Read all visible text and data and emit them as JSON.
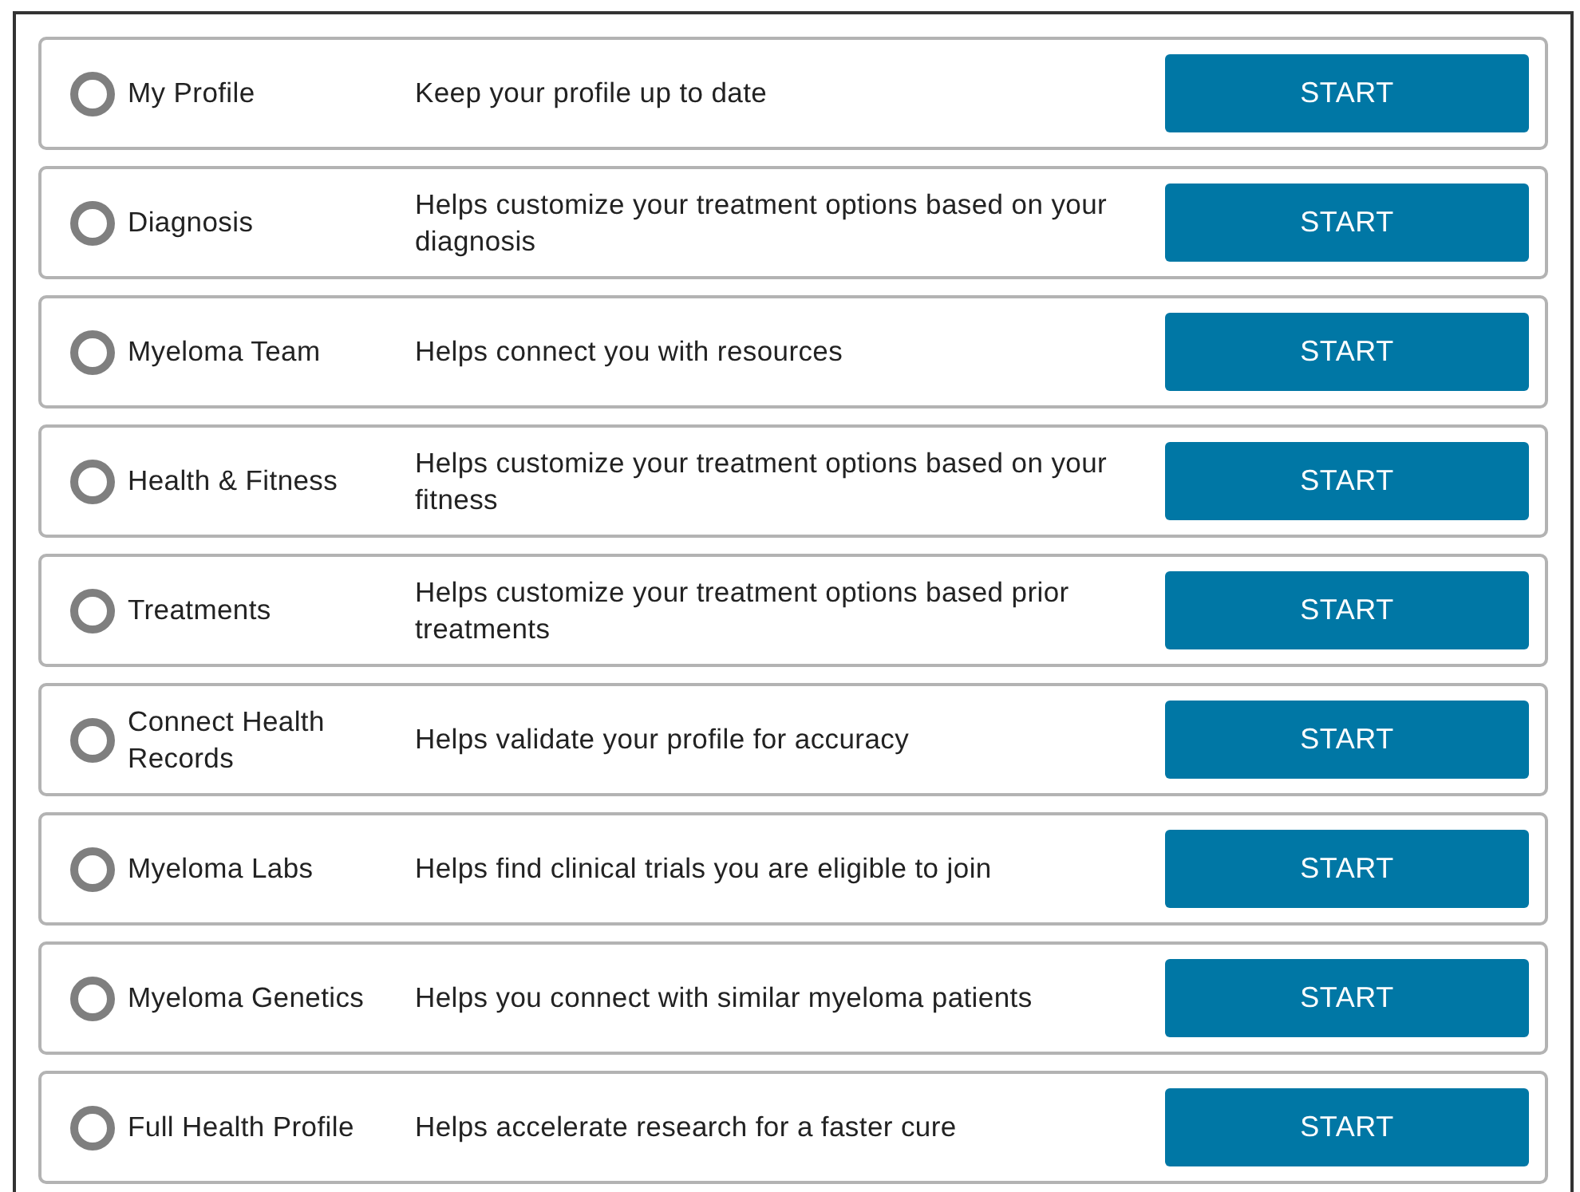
{
  "steps": [
    {
      "title": "My Profile",
      "description": "Keep your profile up to date",
      "button": "START",
      "completed": false
    },
    {
      "title": "Diagnosis",
      "description": "Helps customize your treatment options based on your diagnosis",
      "button": "START",
      "completed": false
    },
    {
      "title": "Myeloma Team",
      "description": "Helps connect you with resources",
      "button": "START",
      "completed": false
    },
    {
      "title": "Health & Fitness",
      "description": "Helps customize your treatment options based on your fitness",
      "button": "START",
      "completed": false
    },
    {
      "title": "Treatments",
      "description": "Helps customize your treatment options based prior treatments",
      "button": "START",
      "completed": false
    },
    {
      "title": "Connect Health Records",
      "description": "Helps validate your profile for accuracy",
      "button": "START",
      "completed": false
    },
    {
      "title": "Myeloma Labs",
      "description": "Helps find clinical trials you are eligible to join",
      "button": "START",
      "completed": false
    },
    {
      "title": "Myeloma Genetics",
      "description": "Helps you connect with similar myeloma patients",
      "button": "START",
      "completed": false
    },
    {
      "title": "Full Health Profile",
      "description": "Helps accelerate research for a faster cure",
      "button": "START",
      "completed": false
    }
  ]
}
